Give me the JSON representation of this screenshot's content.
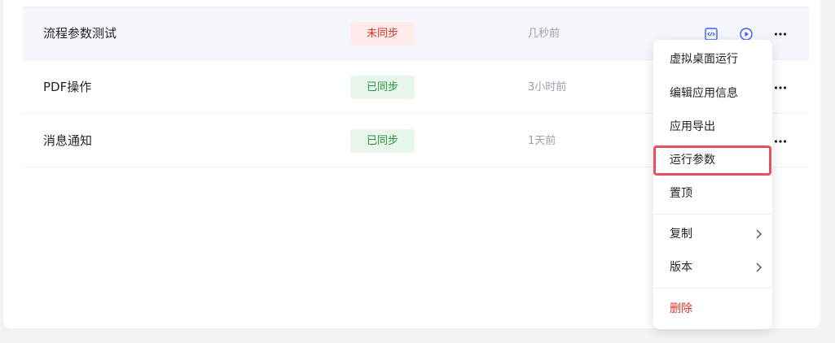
{
  "rows": [
    {
      "name": "流程参数测试",
      "status": "未同步",
      "updated": "几秒前"
    },
    {
      "name": "PDF操作",
      "status": "已同步",
      "updated": "3小时前"
    },
    {
      "name": "消息通知",
      "status": "已同步",
      "updated": "1天前"
    }
  ],
  "menu": {
    "items": [
      {
        "label": "虚拟桌面运行"
      },
      {
        "label": "编辑应用信息"
      },
      {
        "label": "应用导出"
      },
      {
        "label": "运行参数"
      },
      {
        "label": "置顶"
      },
      {
        "label": "复制"
      },
      {
        "label": "版本"
      },
      {
        "label": "删除"
      }
    ]
  },
  "icons": {
    "code": "code-icon",
    "run": "play-circle-icon",
    "more": "more-horizontal-icon",
    "submenu": "chevron-right-icon"
  },
  "colors": {
    "unsynced_text": "#d6382c",
    "unsynced_bg": "#fdecea",
    "synced_text": "#27973f",
    "synced_bg": "#e8f6ec",
    "accent": "#3a5cf5",
    "danger": "#e0352b",
    "highlight_border": "#e8505e"
  }
}
